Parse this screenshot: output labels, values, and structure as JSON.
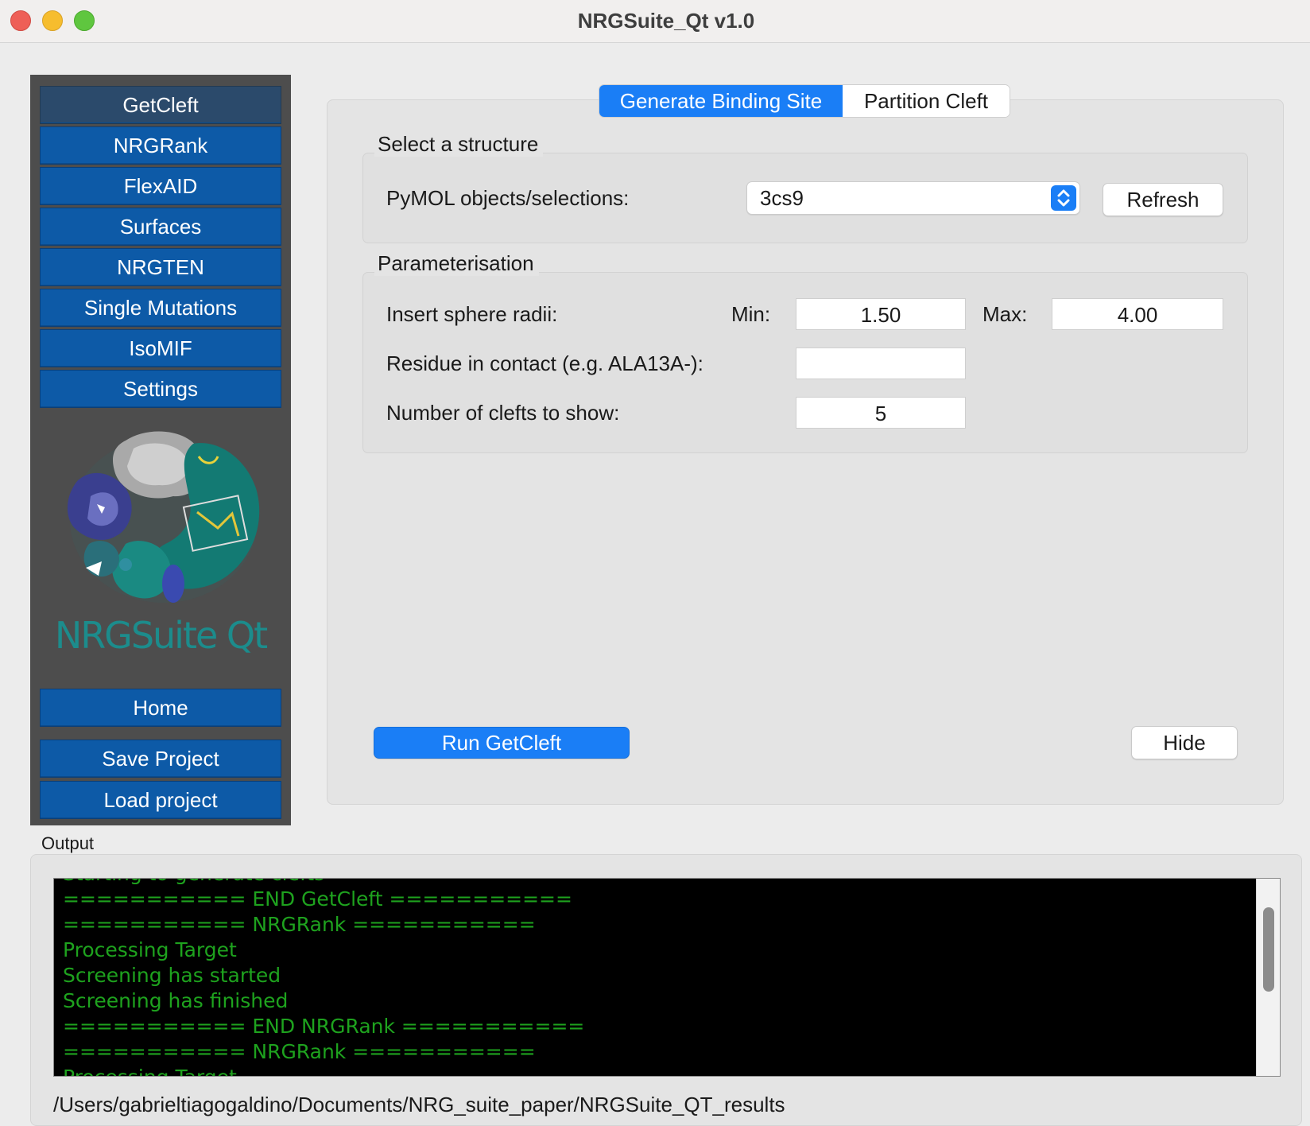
{
  "window": {
    "title": "NRGSuite_Qt v1.0"
  },
  "sidebar": {
    "items": [
      {
        "label": "GetCleft"
      },
      {
        "label": "NRGRank"
      },
      {
        "label": "FlexAID"
      },
      {
        "label": "Surfaces"
      },
      {
        "label": "NRGTEN"
      },
      {
        "label": "Single Mutations"
      },
      {
        "label": "IsoMIF"
      },
      {
        "label": "Settings"
      }
    ],
    "logo_text": "NRGSuite Qt",
    "home_label": "Home",
    "save_label": "Save Project",
    "load_label": "Load project"
  },
  "tabs": [
    {
      "label": "Generate Binding Site"
    },
    {
      "label": "Partition Cleft"
    }
  ],
  "structure": {
    "group_title": "Select a structure",
    "objects_label": "PyMOL objects/selections:",
    "selected_object": "3cs9",
    "refresh_label": "Refresh"
  },
  "params": {
    "group_title": "Parameterisation",
    "radii_label": "Insert sphere radii:",
    "min_label": "Min:",
    "min_value": "1.50",
    "max_label": "Max:",
    "max_value": "4.00",
    "residue_label": "Residue in contact (e.g. ALA13A-):",
    "residue_value": "",
    "clefts_label": "Number of clefts to show:",
    "clefts_value": "5"
  },
  "actions": {
    "run_label": "Run GetCleft",
    "hide_label": "Hide"
  },
  "output": {
    "label": "Output",
    "lines": [
      "Starting to generate clefts",
      "=========== END GetCleft ===========",
      "=========== NRGRank ===========",
      "Processing Target",
      "Screening has started",
      "Screening has finished",
      "=========== END NRGRank ===========",
      "=========== NRGRank ===========",
      "Processing Target"
    ],
    "path": "/Users/gabrieltiagogaldino/Documents/NRG_suite_paper/NRGSuite_QT_results"
  },
  "colors": {
    "accent": "#1a7ef6",
    "nav_button": "#0d5aa7",
    "sidebar_bg": "#4d4d4d",
    "console_text": "#1ea21e"
  }
}
